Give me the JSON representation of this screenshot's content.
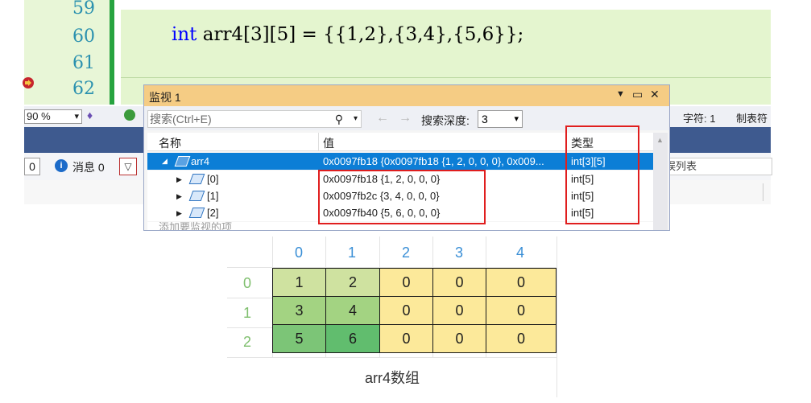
{
  "editor": {
    "line_numbers": [
      "59",
      "60",
      "61",
      "62"
    ],
    "code": {
      "keyword": "int",
      "rest": " arr4[3][5] = {{1,2},{3,4},{5,6}};"
    }
  },
  "status": {
    "zoom": "90 %",
    "char_pos": "字符: 1",
    "tab_mode": "制表符"
  },
  "error_list": {
    "error_count": "0",
    "messages_label": "消息 0",
    "search_placeholder": "误列表"
  },
  "watch": {
    "title": "监视 1",
    "search_placeholder": "搜索(Ctrl+E)",
    "search_depth_label": "搜索深度:",
    "search_depth_value": "3",
    "columns": {
      "name": "名称",
      "value": "值",
      "type": "类型"
    },
    "rows": [
      {
        "name": "arr4",
        "value": "0x0097fb18 {0x0097fb18 {1, 2, 0, 0, 0}, 0x009...",
        "type": "int[3][5]"
      },
      {
        "name": "[0]",
        "value": "0x0097fb18 {1, 2, 0, 0, 0}",
        "type": "int[5]"
      },
      {
        "name": "[1]",
        "value": "0x0097fb2c {3, 4, 0, 0, 0}",
        "type": "int[5]"
      },
      {
        "name": "[2]",
        "value": "0x0097fb40 {5, 6, 0, 0, 0}",
        "type": "int[5]"
      }
    ],
    "add_item": "添加要监视的项"
  },
  "array_figure": {
    "col_headers": [
      "0",
      "1",
      "2",
      "3",
      "4"
    ],
    "row_headers": [
      "0",
      "1",
      "2"
    ],
    "cells": [
      [
        "1",
        "2",
        "0",
        "0",
        "0"
      ],
      [
        "3",
        "4",
        "0",
        "0",
        "0"
      ],
      [
        "5",
        "6",
        "0",
        "0",
        "0"
      ]
    ],
    "caption": "arr4数组",
    "colors": {
      "yellow": "#fce99a",
      "light_green": "#cfe2a0",
      "mid_green": "#a3d382",
      "green": "#86c87a",
      "dark_green": "#61bd6e"
    }
  }
}
